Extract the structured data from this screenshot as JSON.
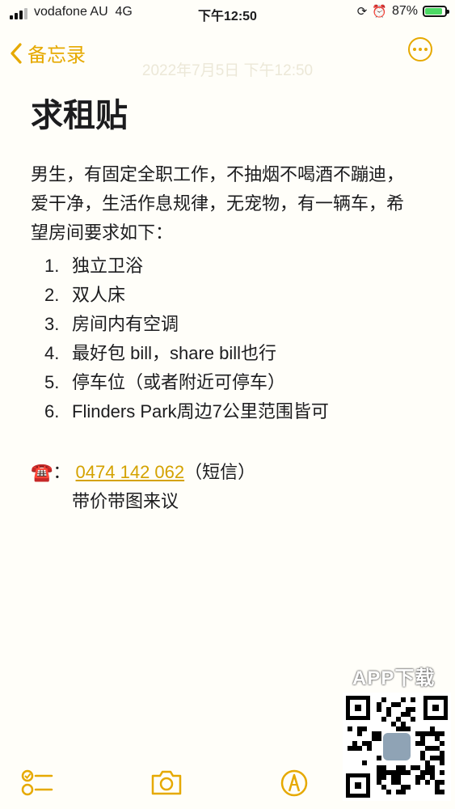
{
  "status": {
    "carrier": "vodafone AU",
    "network": "4G",
    "time": "下午12:50",
    "battery": "87%",
    "battery_level": 0.87
  },
  "nav": {
    "back_label": "备忘录",
    "subtitle": "2022年7月5日 下午12:50"
  },
  "note": {
    "title": "求租贴",
    "intro": "男生，有固定全职工作，不抽烟不喝酒不蹦迪，爱干净，生活作息规律，无宠物，有一辆车，希望房间要求如下：",
    "items": [
      {
        "num": "1.",
        "text": "独立卫浴"
      },
      {
        "num": "2.",
        "text": "双人床"
      },
      {
        "num": "3.",
        "text": "房间内有空调"
      },
      {
        "num": "4.",
        "text": "最好包 bill，share bill也行"
      },
      {
        "num": "5.",
        "text": "停车位（或者附近可停车）"
      },
      {
        "num": "6.",
        "text": "Flinders Park周边7公里范围皆可"
      }
    ],
    "contact_emoji": "☎️",
    "contact_sep": "：",
    "phone": "0474 142 062",
    "phone_note": "（短信）",
    "extra": "带价带图来议"
  },
  "watermark": {
    "label": "APP下载"
  },
  "colors": {
    "accent": "#e6a900",
    "background": "#fffef9"
  },
  "icons": [
    "checklist-icon",
    "camera-icon",
    "markup-pen-icon",
    "more-icon",
    "chevron-left-icon",
    "qr-code"
  ]
}
